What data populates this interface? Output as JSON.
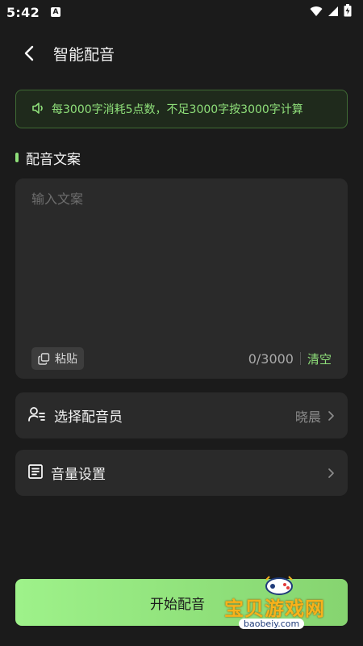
{
  "statusbar": {
    "time": "5:42",
    "badge": "A"
  },
  "header": {
    "title": "智能配音"
  },
  "notice": {
    "text": "每3000字消耗5点数，不足3000字按3000字计算"
  },
  "section": {
    "label": "配音文案"
  },
  "editor": {
    "placeholder": "输入文案",
    "value": "",
    "paste_label": "粘贴",
    "count": "0/3000",
    "clear_label": "清空"
  },
  "voice": {
    "label": "选择配音员",
    "value": "晓晨"
  },
  "volume": {
    "label": "音量设置"
  },
  "start": {
    "label": "开始配音"
  },
  "watermark": {
    "text": "宝贝游戏网",
    "url": "baobeiy.com"
  },
  "colors": {
    "accent": "#8fe07a",
    "background": "#1b1b1b",
    "card": "#2a2a2a"
  }
}
